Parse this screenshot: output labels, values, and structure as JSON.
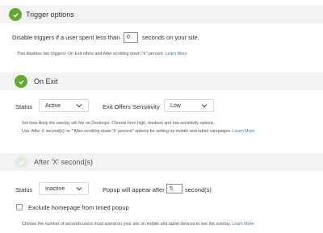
{
  "trigger_options": {
    "title": "Trigger options",
    "disable_prefix": "Disable triggers if a user spent less than",
    "disable_value": "0",
    "disable_suffix": "seconds on your site.",
    "note": "This disables two triggers- On Exit offers and After scrolling down \"X\" percent.",
    "learn_more": "Learn More"
  },
  "on_exit": {
    "title": "On Exit",
    "status_label": "Status",
    "status_value": "Active",
    "sensitivity_label": "Exit Offers Sensitivity",
    "sensitivity_value": "Low",
    "note_line1": "Set how likely the overlay will fire on Desktops. Choose from high, medium and low sensitivity options.",
    "note_line2": "Use 'After X second(s)' or \"'After scrolling down 'X' percent\" options for setting up mobile and tablet campaigns.",
    "learn_more": "Learn More"
  },
  "after_x_seconds": {
    "title": "After 'X' second(s)",
    "status_label": "Status",
    "status_value": "Inactive",
    "appear_label": "Popup will appear after",
    "appear_value": "5",
    "appear_suffix": "second(s)",
    "exclude_label": "Exclude homepage from timed popup",
    "note": "Choose the number of seconds users must spend on your site on mobile and tablet devices to see the overlay.",
    "learn_more": "Learn More"
  },
  "colors": {
    "accent_green": "#63a832",
    "link_blue": "#3f73c8",
    "bar_gray": "#f3f3f3"
  }
}
